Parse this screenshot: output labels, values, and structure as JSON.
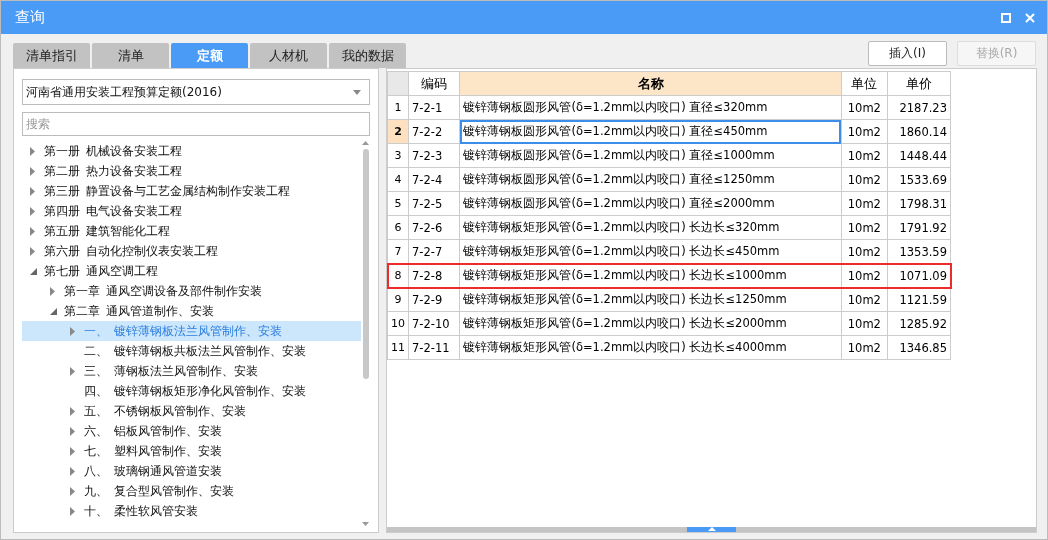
{
  "window": {
    "title": "查询"
  },
  "tabs": [
    {
      "label": "清单指引",
      "selected": false
    },
    {
      "label": "清单",
      "selected": false
    },
    {
      "label": "定额",
      "selected": true
    },
    {
      "label": "人材机",
      "selected": false
    },
    {
      "label": "我的数据",
      "selected": false
    }
  ],
  "buttons": [
    {
      "label": "插入(I)",
      "disabled": false
    },
    {
      "label": "替换(R)",
      "disabled": true
    }
  ],
  "library_select": {
    "value": "河南省通用安装工程预算定额(2016)"
  },
  "search": {
    "placeholder": "搜索"
  },
  "tree": [
    {
      "number": "第一册",
      "label": "机械设备安装工程",
      "expandable": true,
      "expanded": false,
      "selected": false
    },
    {
      "number": "第二册",
      "label": "热力设备安装工程",
      "expandable": true,
      "expanded": false,
      "selected": false
    },
    {
      "number": "第三册",
      "label": "静置设备与工艺金属结构制作安装工程",
      "expandable": true,
      "expanded": false,
      "selected": false
    },
    {
      "number": "第四册",
      "label": "电气设备安装工程",
      "expandable": true,
      "expanded": false,
      "selected": false
    },
    {
      "number": "第五册",
      "label": "建筑智能化工程",
      "expandable": true,
      "expanded": false,
      "selected": false
    },
    {
      "number": "第六册",
      "label": "自动化控制仪表安装工程",
      "expandable": true,
      "expanded": false,
      "selected": false
    },
    {
      "number": "第七册",
      "label": "通风空调工程",
      "expandable": true,
      "expanded": true,
      "selected": false,
      "children": [
        {
          "number": "第一章",
          "label": "通风空调设备及部件制作安装",
          "expandable": true,
          "expanded": false,
          "selected": false
        },
        {
          "number": "第二章",
          "label": "通风管道制作、安装",
          "expandable": true,
          "expanded": true,
          "selected": false,
          "children": [
            {
              "number": "一、",
              "label": "镀锌薄钢板法兰风管制作、安装",
              "expandable": true,
              "expanded": false,
              "selected": true
            },
            {
              "number": "二、",
              "label": "镀锌薄钢板共板法兰风管制作、安装",
              "expandable": false,
              "expanded": false,
              "selected": false
            },
            {
              "number": "三、",
              "label": "薄钢板法兰风管制作、安装",
              "expandable": true,
              "expanded": false,
              "selected": false
            },
            {
              "number": "四、",
              "label": "镀锌薄钢板矩形净化风管制作、安装",
              "expandable": false,
              "expanded": false,
              "selected": false
            },
            {
              "number": "五、",
              "label": "不锈钢板风管制作、安装",
              "expandable": true,
              "expanded": false,
              "selected": false
            },
            {
              "number": "六、",
              "label": "铝板风管制作、安装",
              "expandable": true,
              "expanded": false,
              "selected": false
            },
            {
              "number": "七、",
              "label": "塑料风管制作、安装",
              "expandable": true,
              "expanded": false,
              "selected": false
            },
            {
              "number": "八、",
              "label": "玻璃钢通风管道安装",
              "expandable": true,
              "expanded": false,
              "selected": false
            },
            {
              "number": "九、",
              "label": "复合型风管制作、安装",
              "expandable": true,
              "expanded": false,
              "selected": false
            },
            {
              "number": "十、",
              "label": "柔性软风管安装",
              "expandable": true,
              "expanded": false,
              "selected": false
            }
          ]
        }
      ]
    }
  ],
  "table": {
    "columns": [
      "编码",
      "名称",
      "单位",
      "单价"
    ],
    "rows": [
      {
        "index": "1",
        "code": "7-2-1",
        "name": "镀锌薄钢板圆形风管(δ=1.2mm以内咬口) 直径≤320mm",
        "unit": "10m2",
        "price": "2187.23",
        "selected": false,
        "marked": false
      },
      {
        "index": "2",
        "code": "7-2-2",
        "name": "镀锌薄钢板圆形风管(δ=1.2mm以内咬口) 直径≤450mm",
        "unit": "10m2",
        "price": "1860.14",
        "selected": true,
        "marked": false
      },
      {
        "index": "3",
        "code": "7-2-3",
        "name": "镀锌薄钢板圆形风管(δ=1.2mm以内咬口) 直径≤1000mm",
        "unit": "10m2",
        "price": "1448.44",
        "selected": false,
        "marked": false
      },
      {
        "index": "4",
        "code": "7-2-4",
        "name": "镀锌薄钢板圆形风管(δ=1.2mm以内咬口) 直径≤1250mm",
        "unit": "10m2",
        "price": "1533.69",
        "selected": false,
        "marked": false
      },
      {
        "index": "5",
        "code": "7-2-5",
        "name": "镀锌薄钢板圆形风管(δ=1.2mm以内咬口) 直径≤2000mm",
        "unit": "10m2",
        "price": "1798.31",
        "selected": false,
        "marked": false
      },
      {
        "index": "6",
        "code": "7-2-6",
        "name": "镀锌薄钢板矩形风管(δ=1.2mm以内咬口) 长边长≤320mm",
        "unit": "10m2",
        "price": "1791.92",
        "selected": false,
        "marked": false
      },
      {
        "index": "7",
        "code": "7-2-7",
        "name": "镀锌薄钢板矩形风管(δ=1.2mm以内咬口) 长边长≤450mm",
        "unit": "10m2",
        "price": "1353.59",
        "selected": false,
        "marked": false
      },
      {
        "index": "8",
        "code": "7-2-8",
        "name": "镀锌薄钢板矩形风管(δ=1.2mm以内咬口) 长边长≤1000mm",
        "unit": "10m2",
        "price": "1071.09",
        "selected": false,
        "marked": true
      },
      {
        "index": "9",
        "code": "7-2-9",
        "name": "镀锌薄钢板矩形风管(δ=1.2mm以内咬口) 长边长≤1250mm",
        "unit": "10m2",
        "price": "1121.59",
        "selected": false,
        "marked": false
      },
      {
        "index": "10",
        "code": "7-2-10",
        "name": "镀锌薄钢板矩形风管(δ=1.2mm以内咬口) 长边长≤2000mm",
        "unit": "10m2",
        "price": "1285.92",
        "selected": false,
        "marked": false
      },
      {
        "index": "11",
        "code": "7-2-11",
        "name": "镀锌薄钢板矩形风管(δ=1.2mm以内咬口) 长边长≤4000mm",
        "unit": "10m2",
        "price": "1346.85",
        "selected": false,
        "marked": false
      }
    ]
  }
}
